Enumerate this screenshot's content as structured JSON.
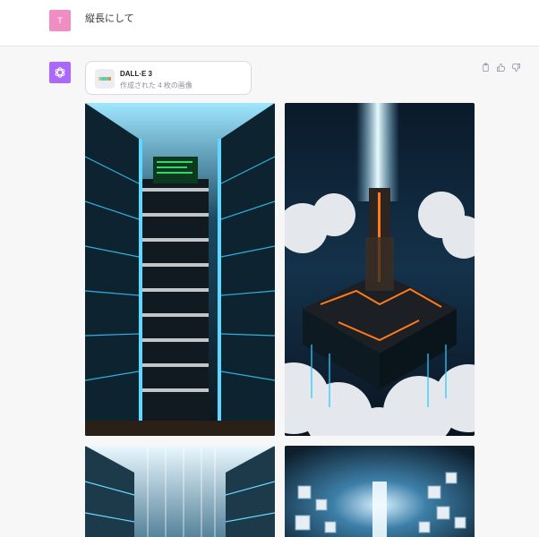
{
  "user_message": {
    "avatar_letter": "T",
    "text": "縦長にして",
    "avatar_color": "#f08ec4"
  },
  "assistant": {
    "avatar_color": "#ab68ff",
    "avatar_icon": "openai-logo-icon"
  },
  "dalle_card": {
    "title": "DALL·E 3",
    "subtitle": "作成された 4 枚の画像"
  },
  "message_actions": [
    "clipboard-icon",
    "thumbs-up-icon",
    "thumbs-down-icon"
  ],
  "generated_images": [
    {
      "subject": "server-tower-atrium",
      "accent": "#4fd6ff"
    },
    {
      "subject": "tower-above-clouds-circuit",
      "accent": "#ff7a1a"
    },
    {
      "subject": "server-tower-atrium-bright",
      "accent": "#9be3ff"
    },
    {
      "subject": "data-cubes-light-beam",
      "accent": "#cfe8ff"
    }
  ]
}
